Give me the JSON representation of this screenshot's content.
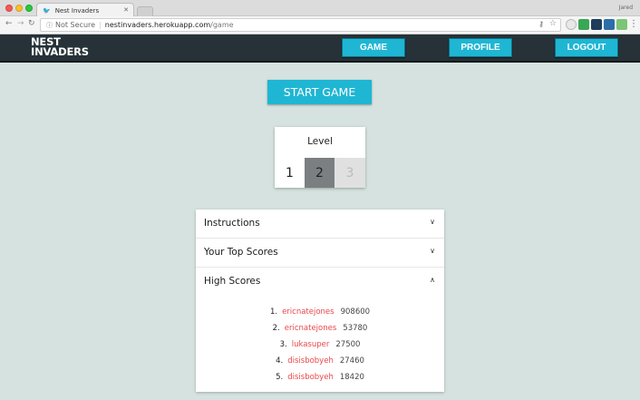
{
  "browser": {
    "tab_title": "Nest Invaders",
    "user": "Jared",
    "security": "Not Secure",
    "url_domain": "nestinvaders.herokuapp.com",
    "url_path": "/game"
  },
  "app": {
    "logo_line1": "NEST",
    "logo_line2": "INVADERS",
    "nav": {
      "game": "GAME",
      "profile": "PROFILE",
      "logout": "LOGOUT"
    },
    "accent_color": "#1fb6d4",
    "header_color": "#263238",
    "background_color": "#d5e2df"
  },
  "start_button": "START GAME",
  "level": {
    "title": "Level",
    "options": [
      "1",
      "2",
      "3"
    ],
    "selected": "2",
    "disabled": "3"
  },
  "accordion": {
    "instructions": "Instructions",
    "top_scores": "Your Top Scores",
    "high_scores": "High Scores",
    "high_scores_list": [
      {
        "rank": "1.",
        "user": "ericnatejones",
        "score": "908600"
      },
      {
        "rank": "2.",
        "user": "ericnatejones",
        "score": "53780"
      },
      {
        "rank": "3.",
        "user": "lukasuper",
        "score": "27500"
      },
      {
        "rank": "4.",
        "user": "disisbobyeh",
        "score": "27460"
      },
      {
        "rank": "5.",
        "user": "disisbobyeh",
        "score": "18420"
      }
    ]
  }
}
